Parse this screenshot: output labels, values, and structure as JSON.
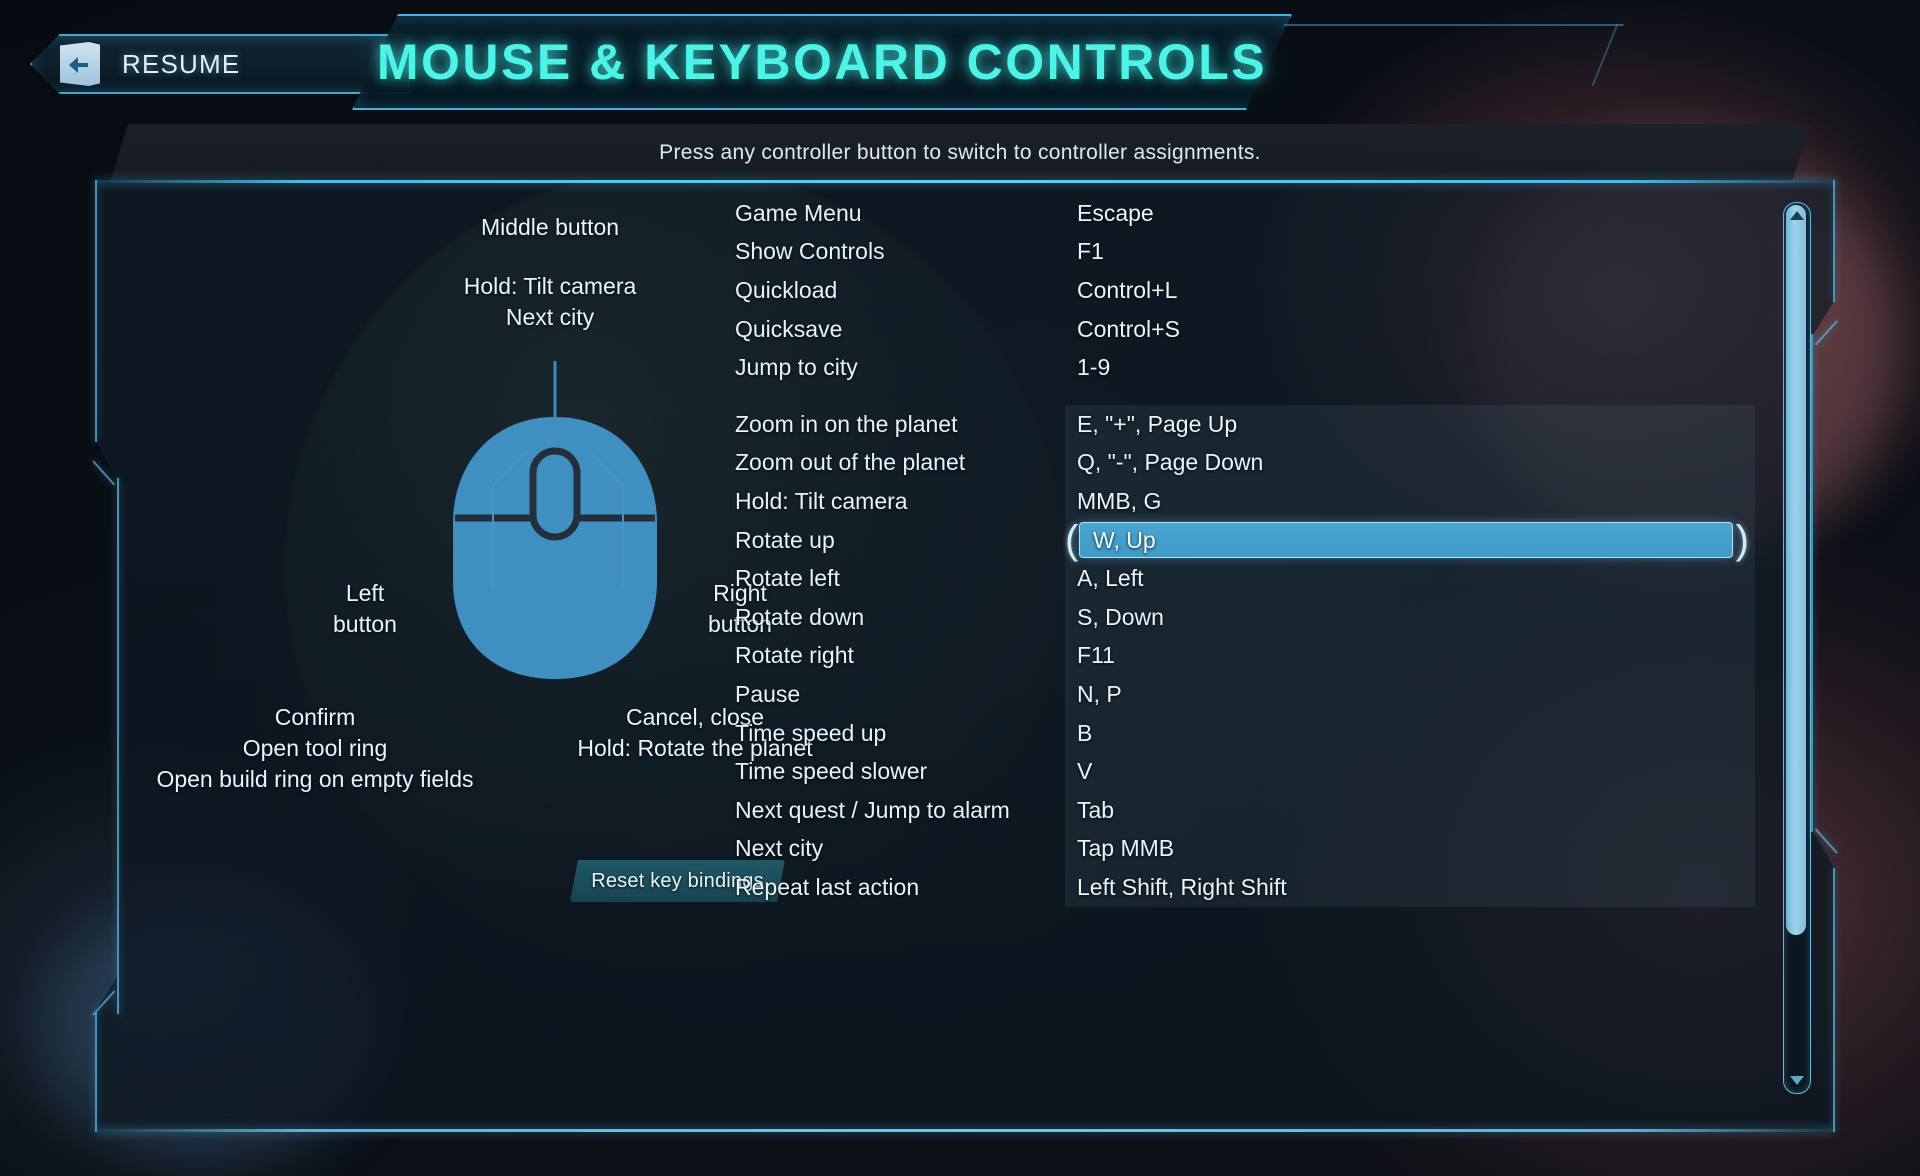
{
  "header": {
    "resume_label": "RESUME",
    "resume_icon": "exit-door-arrow-icon",
    "title": "MOUSE & KEYBOARD CONTROLS"
  },
  "hint": {
    "text": "Press any controller button to switch to controller assignments."
  },
  "mouse_diagram": {
    "middle_button_label": "Middle button",
    "middle_button_functions": "Hold: Tilt camera\nNext city",
    "middle_button_function_1": "Hold: Tilt camera",
    "middle_button_function_2": "Next city",
    "left_button_label": "Left\nbutton",
    "left_button_label_1": "Left",
    "left_button_label_2": "button",
    "right_button_label_1": "Right",
    "right_button_label_2": "button",
    "left_functions_1": "Confirm",
    "left_functions_2": "Open tool ring",
    "left_functions_3": "Open build ring on empty fields",
    "right_functions_1": "Cancel, close",
    "right_functions_2": "Hold: Rotate the planet",
    "mouse_body_color": "#3f8fc0",
    "mouse_outline_color": "#23303c"
  },
  "reset_button": {
    "label": "Reset key bindings"
  },
  "bindings": [
    {
      "action": "Game Menu",
      "key": "Escape",
      "shaded": false,
      "selected": false
    },
    {
      "action": "Show Controls",
      "key": "F1",
      "shaded": false,
      "selected": false
    },
    {
      "action": "Quickload",
      "key": "Control+L",
      "shaded": false,
      "selected": false
    },
    {
      "action": "Quicksave",
      "key": "Control+S",
      "shaded": false,
      "selected": false
    },
    {
      "action": "Jump to city",
      "key": "1-9",
      "shaded": false,
      "selected": false
    },
    {
      "action": "Zoom in on the planet",
      "key": "E, \"+\", Page Up",
      "shaded": true,
      "selected": false
    },
    {
      "action": "Zoom out of the planet",
      "key": "Q, \"-\", Page Down",
      "shaded": true,
      "selected": false
    },
    {
      "action": "Hold: Tilt camera",
      "key": "MMB, G",
      "shaded": true,
      "selected": false
    },
    {
      "action": "Rotate up",
      "key": "W, Up",
      "shaded": true,
      "selected": true
    },
    {
      "action": "Rotate left",
      "key": "A, Left",
      "shaded": true,
      "selected": false
    },
    {
      "action": "Rotate down",
      "key": "S, Down",
      "shaded": true,
      "selected": false
    },
    {
      "action": "Rotate right",
      "key": "F11",
      "shaded": true,
      "selected": false
    },
    {
      "action": "Pause",
      "key": "N, P",
      "shaded": true,
      "selected": false
    },
    {
      "action": "Time speed up",
      "key": "B",
      "shaded": true,
      "selected": false
    },
    {
      "action": "Time speed slower",
      "key": "V",
      "shaded": true,
      "selected": false
    },
    {
      "action": "Next quest / Jump to alarm",
      "key": "Tab",
      "shaded": true,
      "selected": false
    },
    {
      "action": "Next city",
      "key": "Tap MMB",
      "shaded": true,
      "selected": false
    },
    {
      "action": "Repeat last action",
      "key": "Left Shift, Right Shift",
      "shaded": true,
      "selected": false
    }
  ],
  "spacer_after_index": 4,
  "scrollbar": {
    "thumb_percent": 82,
    "up_arrow_icon": "triangle-up-icon",
    "down_arrow_icon": "triangle-down-icon"
  },
  "colors": {
    "accent_cyan": "#4ef3e8",
    "panel_border": "#4fb9e6",
    "selection_blue": "#47a6d2",
    "mouse_blue": "#3f8fc0",
    "text": "#eaf4f9"
  }
}
